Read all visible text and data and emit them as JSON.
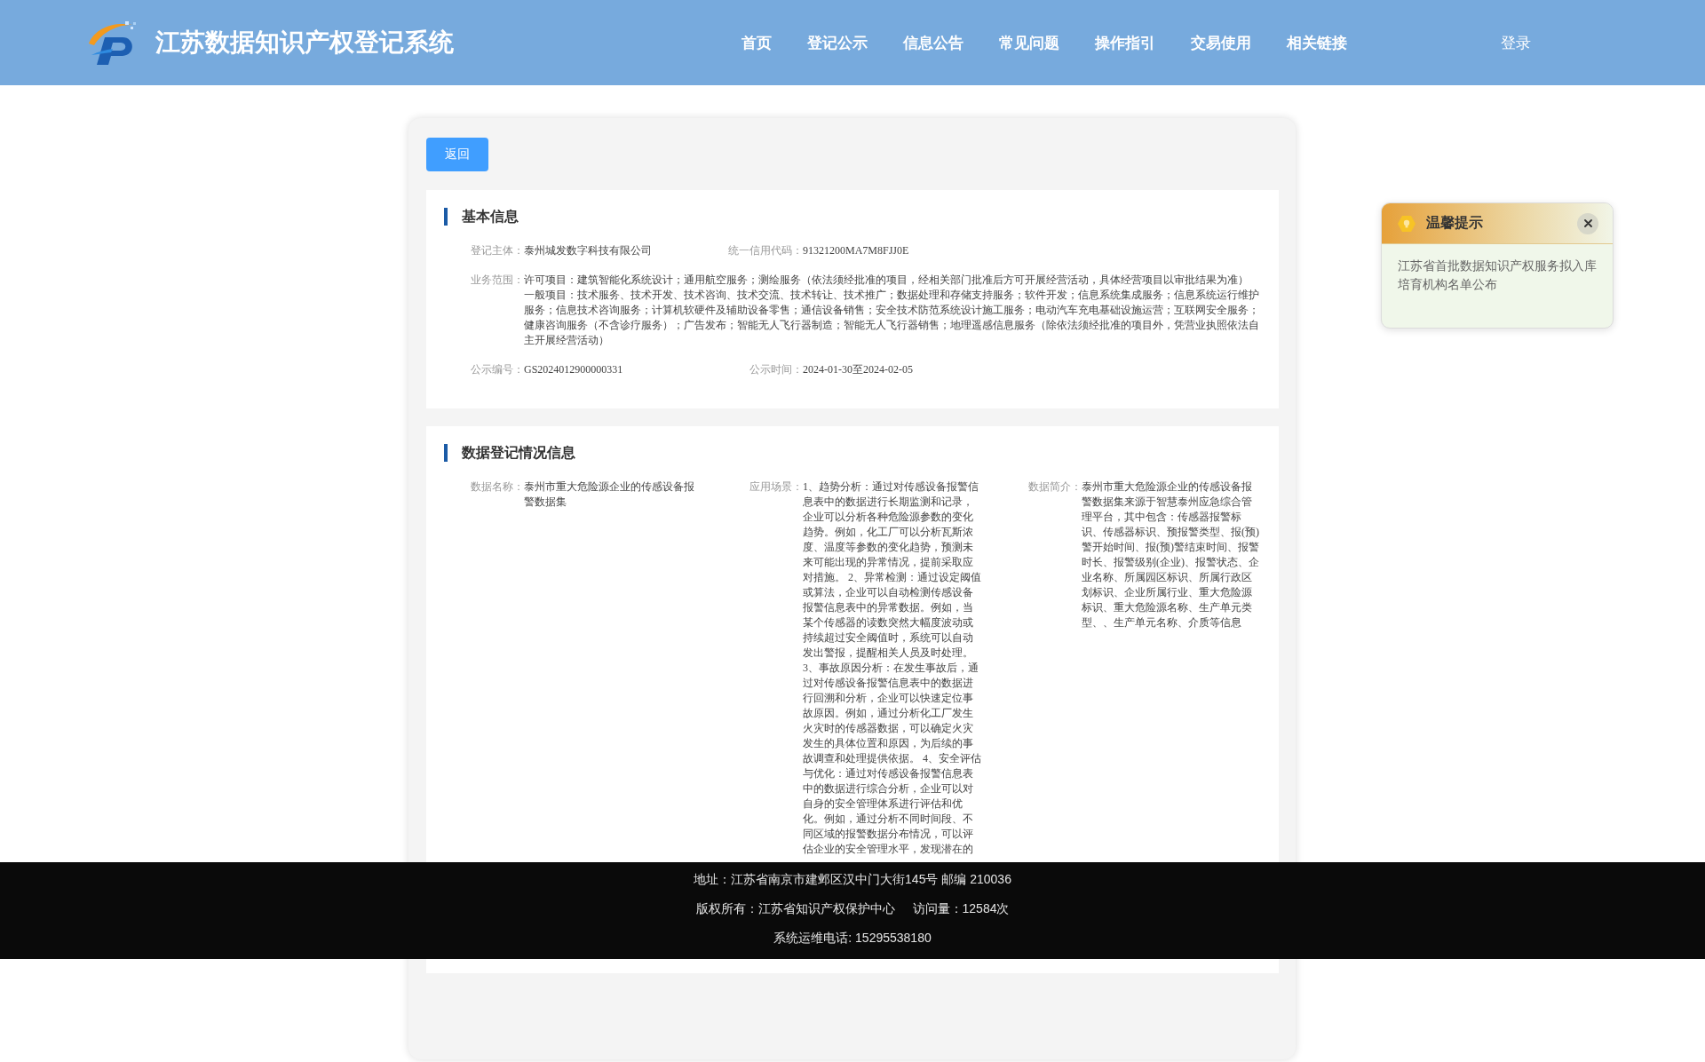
{
  "header": {
    "title": "江苏数据知识产权登记系统",
    "nav": [
      {
        "label": "首页",
        "selected": false
      },
      {
        "label": "登记公示",
        "selected": false
      },
      {
        "label": "信息公告",
        "selected": false
      },
      {
        "label": "常见问题",
        "selected": false
      },
      {
        "label": "操作指引",
        "selected": false
      },
      {
        "label": "交易使用",
        "selected": false
      },
      {
        "label": "相关链接",
        "selected": false
      }
    ],
    "login": "登录"
  },
  "back_button": "返回",
  "sections": [
    {
      "title": "基本信息",
      "fields": [
        {
          "kind": "cell",
          "label": "登记主体：",
          "value": "泰州城发数字科技有限公司"
        },
        {
          "kind": "cell",
          "label": "统一信用代码：",
          "value": "91321200MA7M8FJJ0E"
        },
        {
          "kind": "wide",
          "label": "业务范围：",
          "paragraphs": [
            "许可项目：建筑智能化系统设计；通用航空服务；测绘服务（依法须经批准的项目，经相关部门批准后方可开展经营活动，具体经营项目以审批结果为准）",
            "一般项目：技术服务、技术开发、技术咨询、技术交流、技术转让、技术推广；数据处理和存储支持服务；软件开发；信息系统集成服务；信息系统运行维护服务；信息技术咨询服务；计算机软硬件及辅助设备零售；通信设备销售；安全技术防范系统设计施工服务；电动汽车充电基础设施运营；互联网安全服务；健康咨询服务（不含诊疗服务）；广告发布；智能无人飞行器制造；智能无人飞行器销售；地理遥感信息服务（除依法须经批准的项目外，凭营业执照依法自主开展经营活动）"
          ]
        },
        {
          "kind": "cell",
          "label": "公示编号：",
          "value": "GS2024012900000331"
        },
        {
          "kind": "cell",
          "label": "公示时间：",
          "value": "2024-01-30至2024-02-05"
        }
      ]
    },
    {
      "title": "数据登记情况信息",
      "fields": [
        {
          "kind": "cell",
          "label": "数据名称：",
          "value": "泰州市重大危险源企业的传感设备报警数据集"
        },
        {
          "kind": "cell",
          "label": "应用场景：",
          "value": "1、趋势分析：通过对传感设备报警信息表中的数据进行长期监测和记录，企业可以分析各种危险源参数的变化趋势。例如，化工厂可以分析瓦斯浓度、温度等参数的变化趋势，预测未来可能出现的异常情况，提前采取应对措施。 2、异常检测：通过设定阈值或算法，企业可以自动检测传感设备报警信息表中的异常数据。例如，当某个传感器的读数突然大幅度波动或持续超过安全阈值时，系统可以自动发出警报，提醒相关人员及时处理。 3、事故原因分析：在发生事故后，通过对传感设备报警信息表中的数据进行回溯和分析，企业可以快速定位事故原因。例如，通过分析化工厂发生火灾时的传感器数据，可以确定火灾发生的具体位置和原因，为后续的事故调查和处理提供依据。 4、安全评估与优化：通过对传感设备报警信息表中的数据进行综合分析，企业可以对自身的安全管理体系进行评估和优化。例如，通过分析不同时间段、不同区域的报警数据分布情况，可以评估企业的安全管理水平，发现潜在的"
        },
        {
          "kind": "cell",
          "label": "数据简介：",
          "value": "泰州市重大危险源企业的传感设备报警数据集来源于智慧泰州应急综合管理平台，其中包含：传感器报警标识、传感器标识、预报警类型、报(预)警开始时间、报(预)警结束时间、报警时长、报警级别(企业)、报警状态、企业名称、所属园区标识、所属行政区划标识、企业所属行业、重大危险源标识、重大危险源名称、生产单元类型、、生产单元名称、介质等信息"
        }
      ]
    }
  ],
  "notice": {
    "title": "温馨提示",
    "text": "江苏省首批数据知识产权服务拟入库培育机构名单公布"
  },
  "footer": {
    "lines": [
      [
        "地址：江苏省南京市建邺区汉中门大街145号 邮编 210036"
      ],
      [
        "版权所有：江苏省知识产权保护中心",
        "访问量：12584次"
      ],
      [
        "系统运维电话: 15295538180"
      ]
    ]
  }
}
